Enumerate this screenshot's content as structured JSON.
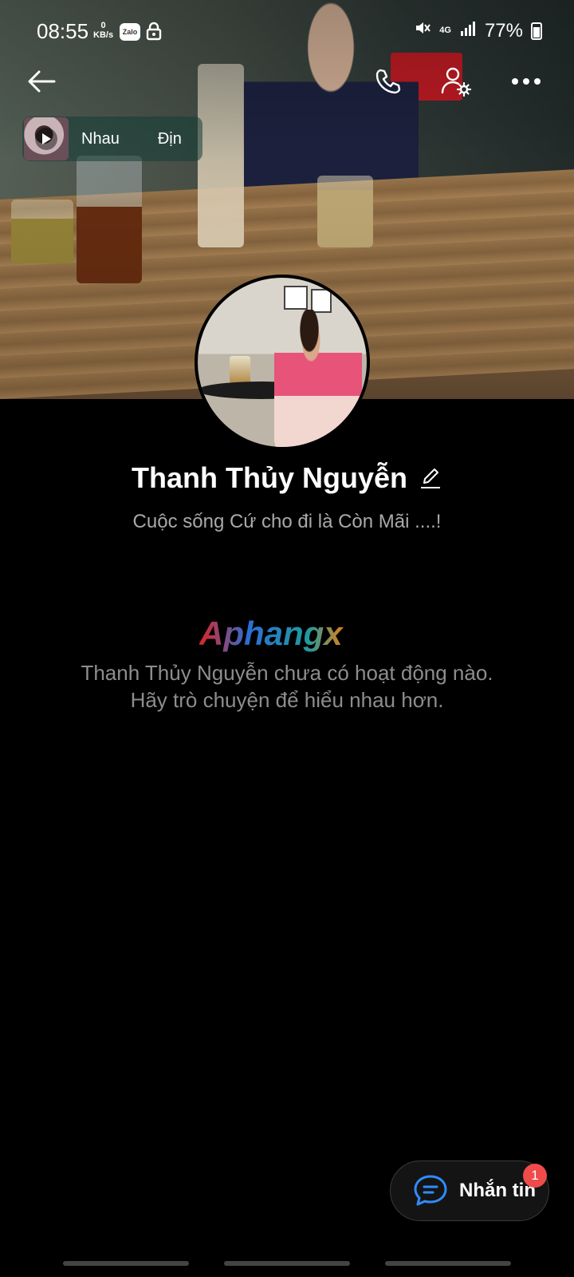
{
  "status_bar": {
    "time": "08:55",
    "net_speed_value": "0",
    "net_speed_unit": "KB/s",
    "app_notification": "Zalo",
    "network": "4G",
    "battery": "77%"
  },
  "header": {
    "back_icon": "arrow-left-icon",
    "call_icon": "phone-icon",
    "settings_icon": "user-gear-icon",
    "more_icon": "more-horizontal-icon"
  },
  "music": {
    "title": "Nhau",
    "title_tail": "Địn"
  },
  "profile": {
    "name": "Thanh Thủy Nguyễn",
    "status": "Cuộc sống Cứ cho đi là Còn Mãi ....!"
  },
  "watermark": "Aphangx",
  "empty_state": {
    "line1": "Thanh Thủy Nguyễn chưa có hoạt động nào.",
    "line2": "Hãy trò chuyện để hiểu nhau hơn."
  },
  "message_button": {
    "label": "Nhắn tin",
    "badge": "1"
  },
  "colors": {
    "badge": "#ef4b4b",
    "accent": "#2f8cff",
    "muted_text": "#8d8d8d"
  }
}
